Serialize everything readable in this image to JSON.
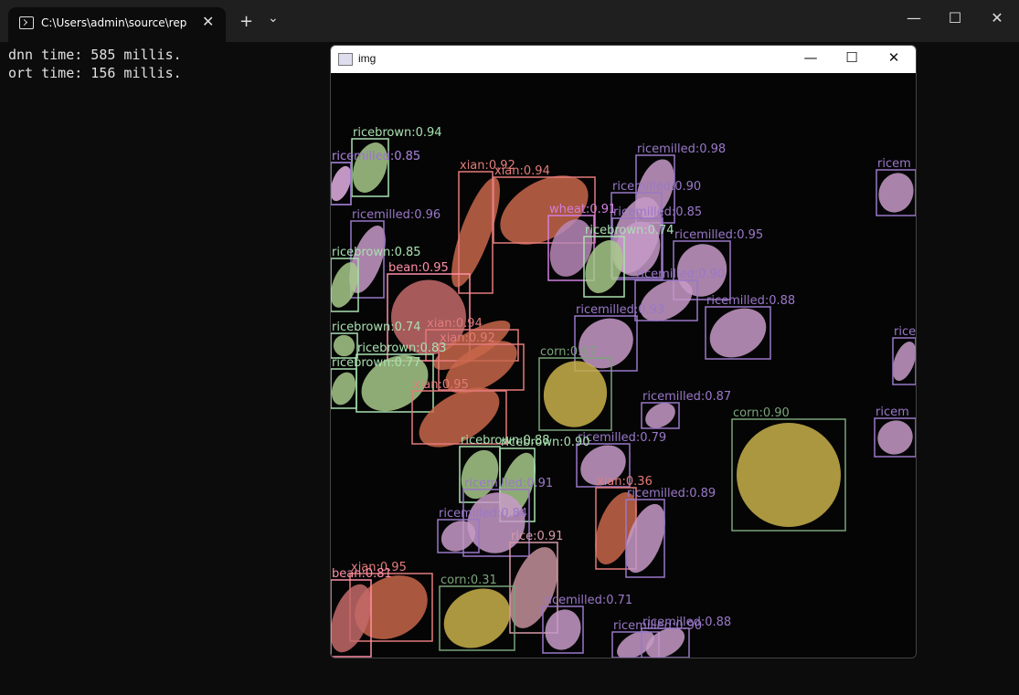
{
  "terminal": {
    "tab_title": "C:\\Users\\admin\\source\\repos",
    "console_lines": [
      "dnn time: 585 millis.",
      "ort time: 156 millis."
    ]
  },
  "img_window": {
    "title": "img"
  },
  "colors": {
    "bean": "#ff8fa6",
    "corn": "#7aa37a",
    "ricebrown": "#a9e0b0",
    "ricemilled": "#9a78c8",
    "wheat": "#d27fe0",
    "xian": "#e37b7b",
    "rice": "#d69aa8"
  },
  "detections": [
    {
      "label": "ricebrown:0.94",
      "cls": "ricebrown"
    },
    {
      "label": "ricemilled:0.85",
      "cls": "ricemilled"
    },
    {
      "label": "xian:0.92",
      "cls": "xian"
    },
    {
      "label": "xian:0.94",
      "cls": "xian"
    },
    {
      "label": "ricemilled:0.98",
      "cls": "ricemilled"
    },
    {
      "label": "ricemilled:0.90",
      "cls": "ricemilled"
    },
    {
      "label": "ricemilled:0.85",
      "cls": "ricemilled"
    },
    {
      "label": "wheat:0.91",
      "cls": "wheat"
    },
    {
      "label": "ricebrown:0.74",
      "cls": "ricebrown"
    },
    {
      "label": "ricemilled:0.95",
      "cls": "ricemilled"
    },
    {
      "label": "ricemilled:0.96",
      "cls": "ricemilled"
    },
    {
      "label": "ricebrown:0.85",
      "cls": "ricebrown"
    },
    {
      "label": "bean:0.95",
      "cls": "bean"
    },
    {
      "label": "ricemilled:0.90",
      "cls": "ricemilled"
    },
    {
      "label": "ricemilled:0.88",
      "cls": "ricemilled"
    },
    {
      "label": "ricemilled:0.93",
      "cls": "ricemilled"
    },
    {
      "label": "ricebrown:0.74",
      "cls": "ricebrown"
    },
    {
      "label": "xian:0.94",
      "cls": "xian"
    },
    {
      "label": "xian:0.92",
      "cls": "xian"
    },
    {
      "label": "ricebrown:0.83",
      "cls": "ricebrown"
    },
    {
      "label": "corn:0.67",
      "cls": "corn"
    },
    {
      "label": "ricebrown:0.77",
      "cls": "ricebrown"
    },
    {
      "label": "xian:0.95",
      "cls": "xian"
    },
    {
      "label": "ricemilled:0.87",
      "cls": "ricemilled"
    },
    {
      "label": "corn:0.90",
      "cls": "corn"
    },
    {
      "label": "ricebrown:0.88",
      "cls": "ricebrown"
    },
    {
      "label": "ricemilled:0.79",
      "cls": "ricemilled"
    },
    {
      "label": "ricebrown:0.90",
      "cls": "ricebrown"
    },
    {
      "label": "ricemilled:0.91",
      "cls": "ricemilled"
    },
    {
      "label": "xian:0.36",
      "cls": "xian"
    },
    {
      "label": "ricemilled:0.89",
      "cls": "ricemilled"
    },
    {
      "label": "ricemilled:0.84",
      "cls": "ricemilled"
    },
    {
      "label": "rice:0.91",
      "cls": "rice"
    },
    {
      "label": "xian:0.95",
      "cls": "xian"
    },
    {
      "label": "bean:0.81",
      "cls": "bean"
    },
    {
      "label": "corn:0.31",
      "cls": "corn"
    },
    {
      "label": "ricemilled:0.71",
      "cls": "ricemilled"
    },
    {
      "label": "ricemilled:0.90",
      "cls": "ricemilled"
    },
    {
      "label": "ricemilled:0.88",
      "cls": "ricemilled"
    },
    {
      "label": "ricem",
      "cls": "ricemilled"
    },
    {
      "label": "rice",
      "cls": "ricemilled"
    },
    {
      "label": "ricem",
      "cls": "ricemilled"
    },
    {
      "label": "ricemilled:0.85",
      "cls": "ricemilled"
    }
  ]
}
